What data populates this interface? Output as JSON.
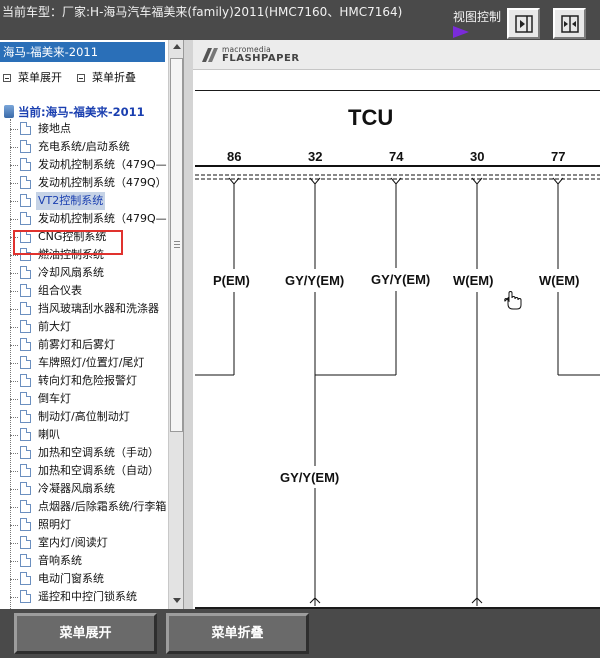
{
  "header": {
    "vehicle_label": "当前车型：厂家:H-海马汽车福美来(family)2011(HMC7160、HMC7164)",
    "view_control_label": "视图控制",
    "arrow_color": "#7a2bd9"
  },
  "left_panel": {
    "title": "海马-福美来-2011",
    "expand_label": "菜单展开",
    "collapse_label": "菜单折叠",
    "tree_root": "当前:海马-福美来-2011",
    "tree_items": [
      "接地点",
      "充电系统/启动系统",
      "发动机控制系统（479Q—",
      "发动机控制系统（479Q）",
      "VT2控制系统",
      "发动机控制系统（479Q—",
      "CNG控制系统",
      "燃油控制系统",
      "冷却风扇系统",
      "组合仪表",
      "挡风玻璃刮水器和洗涤器",
      "前大灯",
      "前雾灯和后雾灯",
      "车牌照灯/位置灯/尾灯",
      "转向灯和危险报警灯",
      "倒车灯",
      "制动灯/高位制动灯",
      "喇叭",
      "加热和空调系统（手动）",
      "加热和空调系统（自动）",
      "冷凝器风扇系统",
      "点烟器/后除霜系统/行李箱",
      "照明灯",
      "室内灯/阅读灯",
      "音响系统",
      "电动门窗系统",
      "遥控和中控门锁系统"
    ],
    "selected_index": 4,
    "highlight_color": "#e0322e"
  },
  "viewer": {
    "brand_top": "macromedia",
    "brand_bottom": "FLASHPAPER",
    "diagram": {
      "component": "TCU",
      "pins": [
        "86",
        "32",
        "74",
        "30",
        "77"
      ],
      "wire_labels": [
        "P(EM)",
        "GY/Y(EM)",
        "GY/Y(EM)",
        "W(EM)",
        "W(EM)"
      ],
      "lower_wire_label": "GY/Y(EM)"
    }
  },
  "bottom_bar": {
    "expand_button": "菜单展开",
    "collapse_button": "菜单折叠"
  }
}
